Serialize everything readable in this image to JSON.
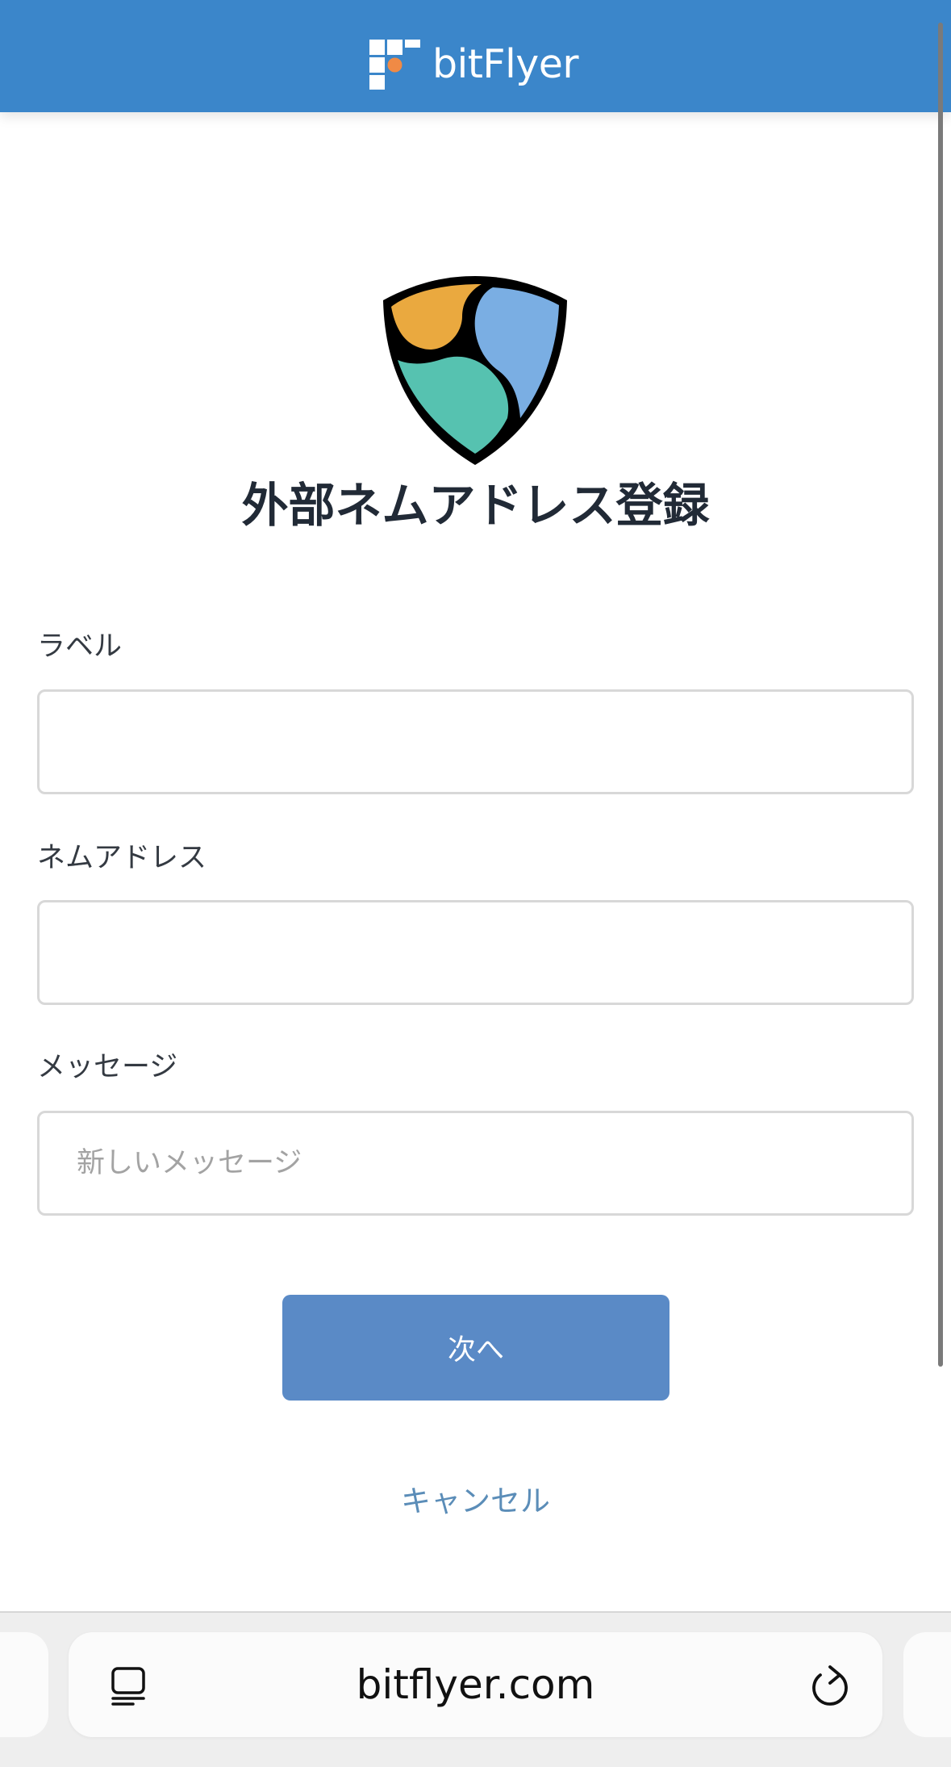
{
  "header": {
    "brand_name": "bitFlyer",
    "logo_icon": "bitflyer-logo-icon",
    "background_color": "#3b86ca"
  },
  "main": {
    "logo_icon": "nem-logo-icon",
    "title": "外部ネムアドレス登録",
    "fields": [
      {
        "label": "ラベル",
        "value": "",
        "placeholder": ""
      },
      {
        "label": "ネムアドレス",
        "value": "",
        "placeholder": ""
      },
      {
        "label": "メッセージ",
        "value": "",
        "placeholder": "新しいメッセージ"
      }
    ],
    "next_button_label": "次へ",
    "cancel_label": "キャンセル",
    "accent_color": "#5a8ac6"
  },
  "browser": {
    "url": "bitflyer.com",
    "page_menu_icon": "page-menu-icon",
    "reload_icon": "reload-icon"
  }
}
